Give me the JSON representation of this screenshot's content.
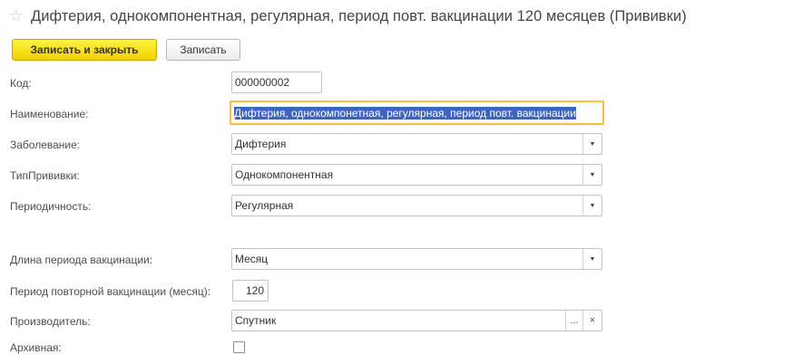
{
  "header": {
    "star_icon": "star-icon",
    "title": "Дифтерия, однокомпонентная, регулярная, период повт. вакцинации 120 месяцев (Прививки)"
  },
  "toolbar": {
    "save_close_label": "Записать и закрыть",
    "save_label": "Записать"
  },
  "form": {
    "code": {
      "label": "Код:",
      "value": "000000002"
    },
    "name": {
      "label": "Наименование:",
      "value": "Дифтерия, однокомпонетная, регулярная, период повт. вакцинации"
    },
    "disease": {
      "label": "Заболевание:",
      "value": "Дифтерия"
    },
    "vaccine_type": {
      "label": "ТипПрививки:",
      "value": "Однокомпонентная"
    },
    "periodicity": {
      "label": "Периодичность:",
      "value": "Регулярная"
    },
    "period_length": {
      "label": "Длина периода вакцинации:",
      "value": "Месяц"
    },
    "repeat_period": {
      "label": "Период повторной вакцинации (месяц):",
      "value": "120"
    },
    "manufacturer": {
      "label": "Производитель:",
      "value": "Спутник",
      "select_glyph": "...",
      "clear_glyph": "×"
    },
    "archived": {
      "label": "Архивная:",
      "checked": false
    }
  },
  "colors": {
    "primary_button": "#f2d100",
    "focus_border": "#f3c23a",
    "selection": "#3f63c0"
  }
}
